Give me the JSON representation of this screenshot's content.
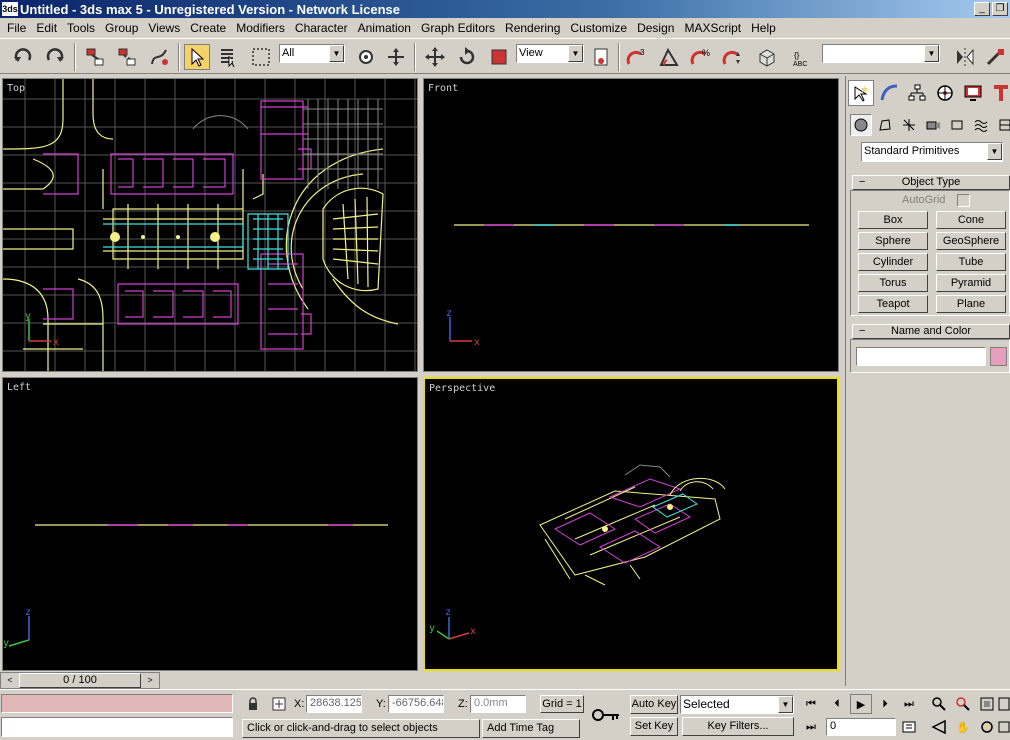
{
  "window": {
    "title": "Untitled - 3ds max 5 - Unregistered Version - Network License",
    "app_icon": "3ds"
  },
  "menu": [
    "File",
    "Edit",
    "Tools",
    "Group",
    "Views",
    "Create",
    "Modifiers",
    "Character",
    "Animation",
    "Graph Editors",
    "Rendering",
    "Customize",
    "Design",
    "MAXScript",
    "Help"
  ],
  "toolbar": {
    "selection_filter": "All",
    "ref_coord": "View",
    "named_selection": ""
  },
  "viewports": {
    "top": "Top",
    "front": "Front",
    "left": "Left",
    "perspective": "Perspective"
  },
  "axis": {
    "x": "x",
    "y": "y",
    "z": "z"
  },
  "command_panel": {
    "category": "Standard Primitives",
    "object_type_title": "Object Type",
    "autogrid": "AutoGrid",
    "buttons": [
      "Box",
      "Cone",
      "Sphere",
      "GeoSphere",
      "Cylinder",
      "Tube",
      "Torus",
      "Pyramid",
      "Teapot",
      "Plane"
    ],
    "name_color_title": "Name and Color",
    "object_name": "",
    "object_color": "#e79ebc"
  },
  "timeline": {
    "frame": "0 / 100"
  },
  "status": {
    "prompt": "Click or click-and-drag to select objects",
    "add_time_tag": "Add Time Tag",
    "x_label": "X:",
    "x_value": "28638.125",
    "y_label": "Y:",
    "y_value": "-66756.648",
    "z_label": "Z:",
    "z_value": "0.0mm",
    "grid": "Grid = 1",
    "auto_key": "Auto Key",
    "set_key": "Set Key",
    "key_mode": "Selected",
    "key_filters": "Key Filters...",
    "current_frame": "0"
  },
  "colors": {
    "active_viewport": "#e8e000",
    "viewport_bg": "#000000",
    "cad_yellow": "#f2f287",
    "cad_magenta": "#d040d0",
    "cad_cyan": "#40e0e0"
  }
}
